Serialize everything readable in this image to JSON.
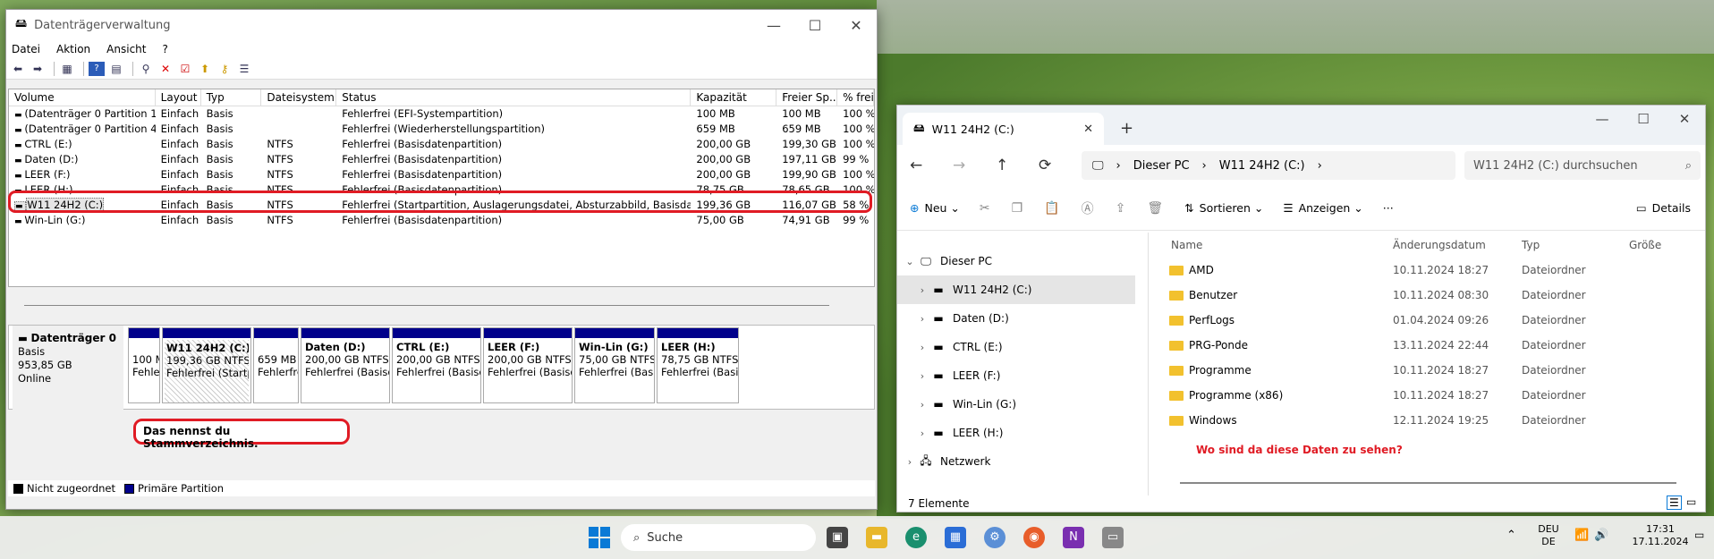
{
  "diskmgmt": {
    "title": "Datenträgerverwaltung",
    "controls": {
      "min": "—",
      "max": "☐",
      "close": "✕"
    },
    "menu": [
      "Datei",
      "Aktion",
      "Ansicht",
      "?"
    ],
    "columns": [
      "Volume",
      "Layout",
      "Typ",
      "Dateisystem",
      "Status",
      "Kapazität",
      "Freier Sp...",
      "% frei"
    ],
    "rows": [
      [
        "(Datenträger 0 Partition 1)",
        "Einfach",
        "Basis",
        "",
        "Fehlerfrei (EFI-Systempartition)",
        "100 MB",
        "100 MB",
        "100 %"
      ],
      [
        "(Datenträger 0 Partition 4)",
        "Einfach",
        "Basis",
        "",
        "Fehlerfrei (Wiederherstellungspartition)",
        "659 MB",
        "659 MB",
        "100 %"
      ],
      [
        "CTRL (E:)",
        "Einfach",
        "Basis",
        "NTFS",
        "Fehlerfrei (Basisdatenpartition)",
        "200,00 GB",
        "199,30 GB",
        "100 %"
      ],
      [
        "Daten (D:)",
        "Einfach",
        "Basis",
        "NTFS",
        "Fehlerfrei (Basisdatenpartition)",
        "200,00 GB",
        "197,11 GB",
        "99 %"
      ],
      [
        "LEER (F:)",
        "Einfach",
        "Basis",
        "NTFS",
        "Fehlerfrei (Basisdatenpartition)",
        "200,00 GB",
        "199,90 GB",
        "100 %"
      ],
      [
        "LEER (H:)",
        "Einfach",
        "Basis",
        "NTFS",
        "Fehlerfrei (Basisdatenpartition)",
        "78,75 GB",
        "78,65 GB",
        "100 %"
      ],
      [
        "W11 24H2 (C:)",
        "Einfach",
        "Basis",
        "NTFS",
        "Fehlerfrei (Startpartition, Auslagerungsdatei, Absturzabbild, Basisdatenp...",
        "199,36 GB",
        "116,07 GB",
        "58 %"
      ],
      [
        "Win-Lin (G:)",
        "Einfach",
        "Basis",
        "NTFS",
        "Fehlerfrei (Basisdatenpartition)",
        "75,00 GB",
        "74,91 GB",
        "99 %"
      ]
    ],
    "disk": {
      "name": "Datenträger 0",
      "type": "Basis",
      "size": "953,85 GB",
      "state": "Online"
    },
    "partitions": [
      {
        "l1": "",
        "l2": "100 M",
        "l3": "Fehler"
      },
      {
        "l1": "W11 24H2  (C:)",
        "l2": "199,36 GB NTFS",
        "l3": "Fehlerfrei (Startpartit"
      },
      {
        "l1": "",
        "l2": "659 MB",
        "l3": "Fehlerfrei"
      },
      {
        "l1": "Daten  (D:)",
        "l2": "200,00 GB NTFS",
        "l3": "Fehlerfrei (Basisdater"
      },
      {
        "l1": "CTRL  (E:)",
        "l2": "200,00 GB NTFS",
        "l3": "Fehlerfrei (Basisdater"
      },
      {
        "l1": "LEER  (F:)",
        "l2": "200,00 GB NTFS",
        "l3": "Fehlerfrei (Basisdater"
      },
      {
        "l1": "Win-Lin  (G:)",
        "l2": "75,00 GB NTFS",
        "l3": "Fehlerfrei (Basisdat"
      },
      {
        "l1": "LEER  (H:)",
        "l2": "78,75 GB NTFS",
        "l3": "Fehlerfrei (Basisdate"
      }
    ],
    "callout": "Das nennst du Stammverzeichnis.",
    "legend": {
      "unallocated": "Nicht zugeordnet",
      "primary": "Primäre Partition"
    }
  },
  "explorer": {
    "tab": "W11 24H2 (C:)",
    "breadcrumb": [
      "Dieser PC",
      "W11 24H2 (C:)"
    ],
    "search_placeholder": "W11 24H2 (C:) durchsuchen",
    "cmd": {
      "new": "Neu",
      "sort": "Sortieren",
      "view": "Anzeigen",
      "more": "···",
      "details": "Details"
    },
    "tree": [
      {
        "label": "Dieser PC",
        "level": 0,
        "expanded": true
      },
      {
        "label": "W11 24H2 (C:)",
        "level": 1,
        "selected": true
      },
      {
        "label": "Daten (D:)",
        "level": 1
      },
      {
        "label": "CTRL (E:)",
        "level": 1
      },
      {
        "label": "LEER (F:)",
        "level": 1
      },
      {
        "label": "Win-Lin (G:)",
        "level": 1
      },
      {
        "label": "LEER (H:)",
        "level": 1
      },
      {
        "label": "Netzwerk",
        "level": 0
      }
    ],
    "columns": [
      "Name",
      "Änderungsdatum",
      "Typ",
      "Größe"
    ],
    "files": [
      [
        "AMD",
        "10.11.2024 18:27",
        "Dateiordner"
      ],
      [
        "Benutzer",
        "10.11.2024 08:30",
        "Dateiordner"
      ],
      [
        "PerfLogs",
        "01.04.2024 09:26",
        "Dateiordner"
      ],
      [
        "PRG-Ponde",
        "13.11.2024 22:44",
        "Dateiordner"
      ],
      [
        "Programme",
        "10.11.2024 18:27",
        "Dateiordner"
      ],
      [
        "Programme (x86)",
        "10.11.2024 18:27",
        "Dateiordner"
      ],
      [
        "Windows",
        "12.11.2024 19:25",
        "Dateiordner"
      ]
    ],
    "question": "Wo sind da diese Daten zu sehen?",
    "status": "7 Elemente"
  },
  "taskbar": {
    "search": "Suche",
    "lang1": "DEU",
    "lang2": "DE",
    "time": "17:31",
    "date": "17.11.2024"
  },
  "colors": {
    "accent": "#0a7ad6",
    "highlight": "#e01b24",
    "partition": "#00008b"
  }
}
